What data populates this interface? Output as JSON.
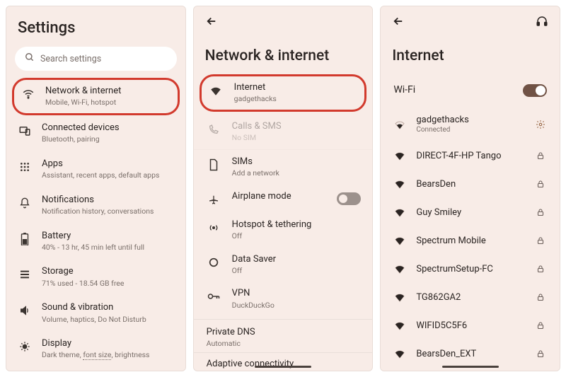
{
  "panel1": {
    "header": "Settings",
    "search_placeholder": "Search settings",
    "items": [
      {
        "title": "Network & internet",
        "sub": "Mobile, Wi-Fi, hotspot",
        "icon": "wifi-icon",
        "highlighted": true
      },
      {
        "title": "Connected devices",
        "sub": "Bluetooth, pairing",
        "icon": "devices-icon"
      },
      {
        "title": "Apps",
        "sub": "Assistant, recent apps, default apps",
        "icon": "apps-icon"
      },
      {
        "title": "Notifications",
        "sub": "Notification history, conversations",
        "icon": "bell-icon"
      },
      {
        "title": "Battery",
        "sub": "40% - 13 hr, 45 min left until full",
        "icon": "battery-icon"
      },
      {
        "title": "Storage",
        "sub": "71% used - 18.54 GB free",
        "icon": "storage-icon"
      },
      {
        "title": "Sound & vibration",
        "sub": "Volume, haptics, Do Not Disturb",
        "icon": "sound-icon"
      },
      {
        "title": "Display",
        "sub_parts": [
          "Dark theme, ",
          "font size",
          ", brightness"
        ],
        "icon": "display-icon"
      }
    ]
  },
  "panel2": {
    "heading": "Network & internet",
    "items": [
      {
        "title": "Internet",
        "sub": "gadgethacks",
        "icon": "wifi-filled-icon",
        "highlighted": true
      },
      {
        "title": "Calls & SMS",
        "sub": "No SIM",
        "icon": "calls-icon",
        "disabled": true
      },
      {
        "title": "SIMs",
        "sub": "Add a network",
        "icon": "sim-icon"
      },
      {
        "title": "Airplane mode",
        "icon": "airplane-icon",
        "toggle": "off"
      },
      {
        "title": "Hotspot & tethering",
        "sub": "Off",
        "icon": "hotspot-icon"
      },
      {
        "title": "Data Saver",
        "sub": "Off",
        "icon": "datasaver-icon"
      },
      {
        "title": "VPN",
        "sub": "DuckDuckGo",
        "icon": "vpn-icon"
      }
    ],
    "private_dns_title": "Private DNS",
    "private_dns_sub": "Automatic",
    "adaptive": "Adaptive connectivity"
  },
  "panel3": {
    "heading": "Internet",
    "wifi_label": "Wi-Fi",
    "wifi_on": true,
    "networks": [
      {
        "name": "gadgethacks",
        "sub": "Connected",
        "signal": 2,
        "trail": "gear"
      },
      {
        "name": "DIRECT-4F-HP Tango",
        "signal": 3,
        "trail": "lock"
      },
      {
        "name": "BearsDen",
        "signal": 3,
        "trail": "lock"
      },
      {
        "name": "Guy Smiley",
        "signal": 3,
        "trail": "lock"
      },
      {
        "name": "Spectrum Mobile",
        "signal": 3,
        "trail": "lock"
      },
      {
        "name": "SpectrumSetup-FC",
        "signal": 3,
        "trail": "lock"
      },
      {
        "name": "TG862GA2",
        "signal": 3,
        "trail": "lock"
      },
      {
        "name": "WIFID5C5F6",
        "signal": 3,
        "trail": "lock"
      },
      {
        "name": "BearsDen_EXT",
        "signal": 3,
        "trail": "lock"
      }
    ]
  }
}
